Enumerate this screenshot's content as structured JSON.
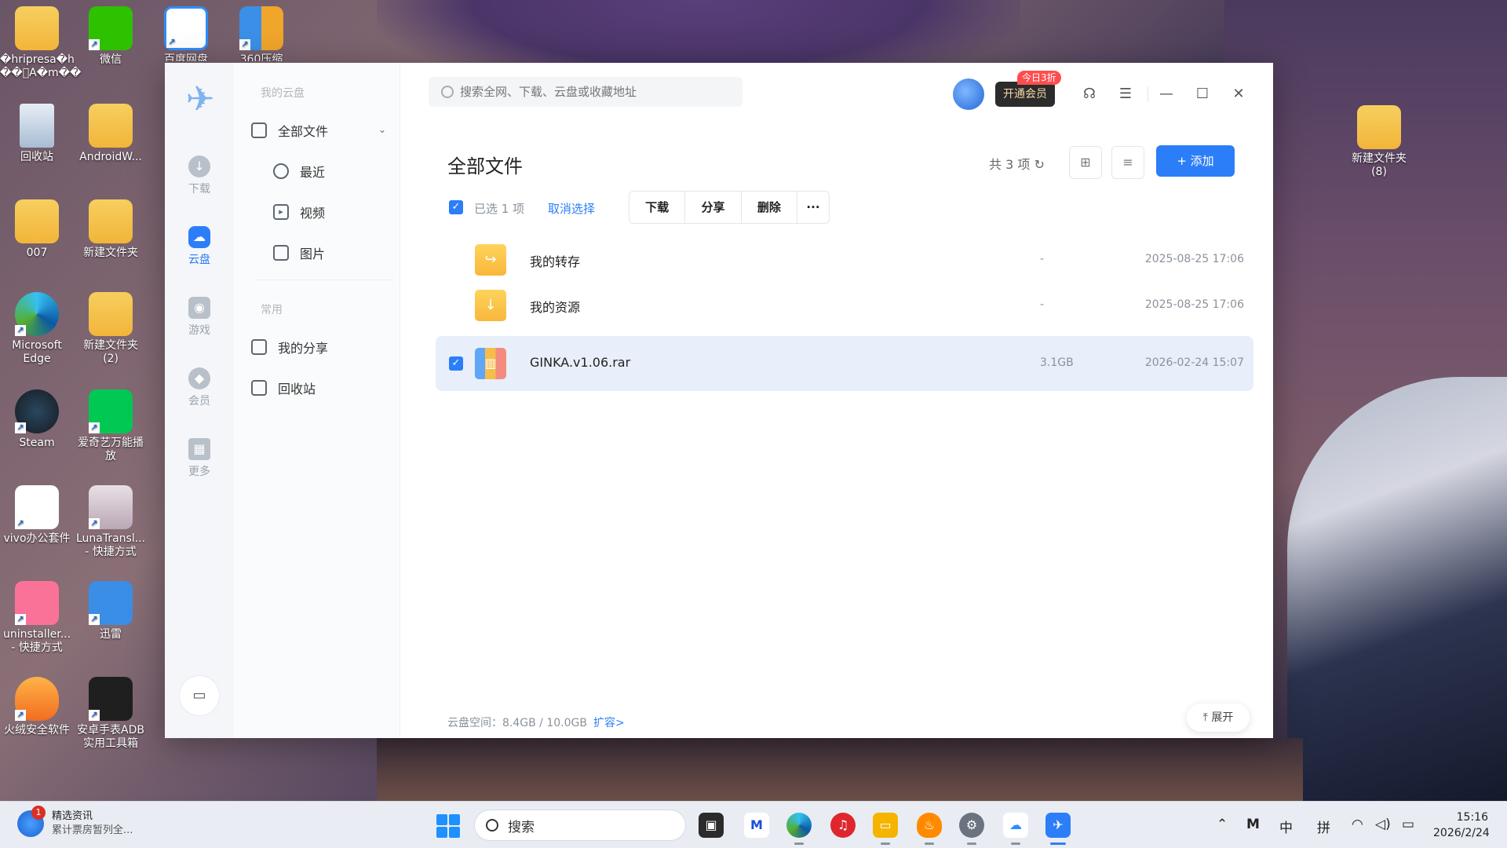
{
  "desktop": {
    "icons": [
      {
        "label": "�hripresa�h ��\u0000A�m��"
      },
      {
        "label": "微信"
      },
      {
        "label": "百度网盘"
      },
      {
        "label": "360压缩"
      },
      {
        "label": "回收站"
      },
      {
        "label": "AndroidW..."
      },
      {
        "label": "007"
      },
      {
        "label": "新建文件夹"
      },
      {
        "label": "Microsoft Edge"
      },
      {
        "label": "新建文件夹 (2)"
      },
      {
        "label": "Steam"
      },
      {
        "label": "爱奇艺万能播放"
      },
      {
        "label": "vivo办公套件"
      },
      {
        "label": "LunaTransl... - 快捷方式"
      },
      {
        "label": "uninstaller... - 快捷方式"
      },
      {
        "label": "迅雷"
      },
      {
        "label": "火绒安全软件"
      },
      {
        "label": "安卓手表ADB实用工具箱"
      },
      {
        "label": "新建文件夹 (8)"
      }
    ]
  },
  "app": {
    "rail": {
      "items": [
        {
          "label": "下载"
        },
        {
          "label": "云盘"
        },
        {
          "label": "游戏"
        },
        {
          "label": "会员"
        },
        {
          "label": "更多"
        }
      ]
    },
    "sidenav": {
      "section1": "我的云盘",
      "all_files": "全部文件",
      "recent": "最近",
      "videos": "视频",
      "images": "图片",
      "section2": "常用",
      "my_shares": "我的分享",
      "recycle": "回收站"
    },
    "search_placeholder": "搜索全网、下载、云盘或收藏地址",
    "vip_button": "开通会员",
    "vip_badge": "今日3折",
    "page_title": "全部文件",
    "count": "共 3 项",
    "add_button": "+ 添加",
    "selection": {
      "selected_text": "已选 1 项",
      "cancel": "取消选择",
      "actions": [
        "下载",
        "分享",
        "删除",
        "···"
      ]
    },
    "files": [
      {
        "name": "我的转存",
        "size": "-",
        "date": "2025-08-25 17:06"
      },
      {
        "name": "我的资源",
        "size": "-",
        "date": "2025-08-25 17:06"
      },
      {
        "name": "GINKA.v1.06.rar",
        "size": "3.1GB",
        "date": "2026-02-24 15:07"
      }
    ],
    "storage_label": "云盘空间：8.4GB / 10.0GB",
    "storage_expand": "扩容>",
    "expand_button": "展开"
  },
  "taskbar": {
    "news_title": "精选资讯",
    "news_sub": "累计票房暂列全...",
    "news_badge": "1",
    "search_label": "搜索",
    "tray_ime1": "中",
    "tray_ime2": "拼",
    "time": "15:16",
    "date": "2026/2/24"
  },
  "colors": {
    "accent": "#2c7ef8",
    "selected_row": "#e8effb",
    "vip_badge": "#ff4d4f"
  }
}
